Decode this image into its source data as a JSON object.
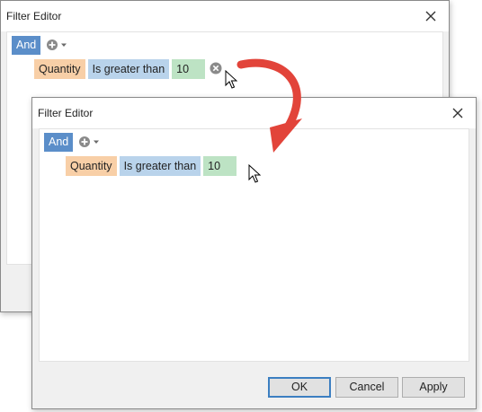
{
  "back_dialog": {
    "title": "Filter Editor",
    "group_operator": "And",
    "condition": {
      "field": "Quantity",
      "operator": "Is greater than",
      "value": "10"
    }
  },
  "front_dialog": {
    "title": "Filter Editor",
    "group_operator": "And",
    "condition": {
      "field": "Quantity",
      "operator": "Is greater than",
      "value": "10"
    },
    "buttons": {
      "ok": "OK",
      "cancel": "Cancel",
      "apply": "Apply"
    }
  },
  "icons": {
    "close": "close-icon",
    "add": "add-condition-icon",
    "dropdown": "chevron-down-icon",
    "remove": "remove-condition-icon",
    "cursor": "mouse-cursor-icon",
    "arrow": "curved-arrow-icon"
  },
  "colors": {
    "group_operator": "#5b8ec9",
    "field_chip": "#f8cfa7",
    "operator_chip": "#b9d3eb",
    "value_chip": "#bde3c4",
    "arrow": "#e2443a"
  }
}
